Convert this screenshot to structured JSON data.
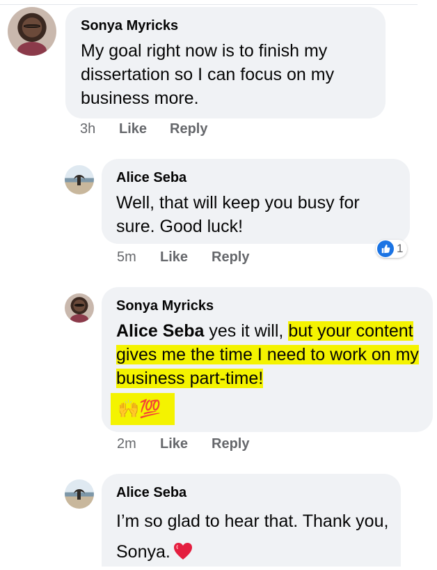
{
  "comments": [
    {
      "author": "Sonya Myricks",
      "text": "My goal right now is to finish my dissertation so I can focus on my business more.",
      "time": "3h",
      "like_label": "Like",
      "reply_label": "Reply"
    },
    {
      "author": "Alice Seba",
      "text": "Well, that will keep you busy for sure. Good luck!",
      "time": "5m",
      "like_label": "Like",
      "reply_label": "Reply",
      "reaction_count": "1",
      "reaction_icon": "thumbs-up-icon"
    },
    {
      "author": "Sonya Myricks",
      "mention": "Alice Seba",
      "text_plain": " yes it will, ",
      "text_highlighted": "but your content gives me the time I need to work on my business part-time!",
      "emoji": "🙌💯",
      "time": "2m",
      "like_label": "Like",
      "reply_label": "Reply"
    },
    {
      "author": "Alice Seba",
      "text": "I’m so glad to hear that. Thank you, Sonya.",
      "emoji_icon": "red-heart-icon",
      "time": "",
      "like_label": "",
      "reply_label": ""
    }
  ],
  "colors": {
    "bubble": "#f0f2f5",
    "meta": "#65676b",
    "highlight": "#f4f300",
    "like_blue": "#1b74e4",
    "heart_red": "#e41e3f"
  }
}
